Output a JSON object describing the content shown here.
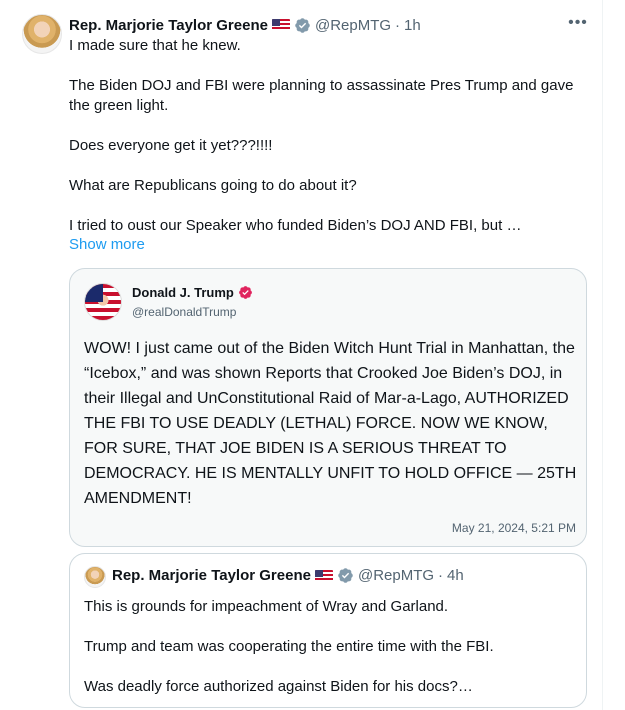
{
  "tweet": {
    "author_name": "Rep. Marjorie Taylor Greene",
    "author_flag": "🇺🇸",
    "handle": "@RepMTG",
    "separator": "·",
    "time": "1h",
    "more_icon": "more-horizontal-icon",
    "lines": [
      "I made sure that he knew.",
      "",
      "The Biden DOJ and FBI were planning to assassinate Pres Trump and gave the green light.",
      "",
      "Does everyone get it yet???!!!!",
      "",
      "What are Republicans going to do about it?",
      "",
      "I tried to oust our Speaker who funded Biden’s DOJ AND FBI, but …"
    ],
    "show_more": "Show more"
  },
  "quote": {
    "author_name": "Donald J. Trump",
    "handle": "@realDonaldTrump",
    "text": "WOW! I just came out of the Biden Witch Hunt Trial in Manhattan, the “Icebox,” and was shown Reports that Crooked Joe Biden’s DOJ, in their Illegal and UnConstitutional Raid of Mar-a-Lago, AUTHORIZED THE FBI TO USE DEADLY (LETHAL) FORCE. NOW WE KNOW, FOR SURE, THAT JOE BIDEN IS A SERIOUS THREAT TO DEMOCRACY. HE IS MENTALLY UNFIT TO HOLD OFFICE — 25TH AMENDMENT!",
    "date": "May 21, 2024, 5:21 PM",
    "badge_color": "#e0245e"
  },
  "quote2": {
    "author_name": "Rep. Marjorie Taylor Greene",
    "author_flag": "🇺🇸",
    "handle": "@RepMTG",
    "separator": "·",
    "time": "4h",
    "lines": [
      "This is grounds for impeachment of Wray and Garland.",
      "",
      "Trump and team was cooperating the entire time with the FBI.",
      "",
      "Was deadly force authorized against Biden for his docs?…"
    ]
  },
  "colors": {
    "link": "#1d9bf0",
    "muted": "#536471",
    "border": "#cfd9de",
    "verified_grey": "#829aab"
  }
}
